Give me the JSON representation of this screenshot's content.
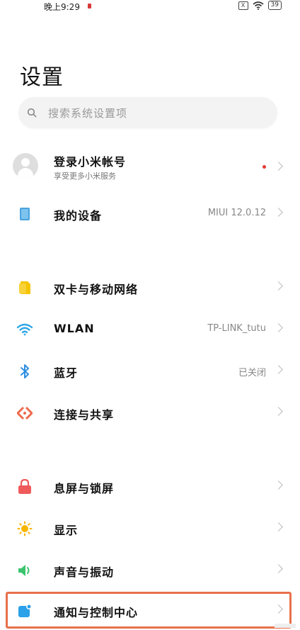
{
  "status_bar": {
    "time": "晚上9:29",
    "sim_badge": "X",
    "battery": "39"
  },
  "page": {
    "title": "设置"
  },
  "search": {
    "placeholder": "搜索系统设置项"
  },
  "account": {
    "title": "登录小米帐号",
    "subtitle": "享受更多小米服务",
    "has_notification": true
  },
  "rows": [
    {
      "label": "我的设备",
      "value": "MIUI 12.0.12",
      "icon": "device-icon"
    },
    {
      "label": "双卡与移动网络",
      "value": "",
      "icon": "sim-card-icon"
    },
    {
      "label": "WLAN",
      "value": "TP-LINK_tutu",
      "icon": "wifi-icon"
    },
    {
      "label": "蓝牙",
      "value": "已关闭",
      "icon": "bluetooth-icon"
    },
    {
      "label": "连接与共享",
      "value": "",
      "icon": "connection-share-icon"
    },
    {
      "label": "息屏与锁屏",
      "value": "",
      "icon": "lock-icon"
    },
    {
      "label": "显示",
      "value": "",
      "icon": "display-brightness-icon"
    },
    {
      "label": "声音与振动",
      "value": "",
      "icon": "speaker-icon"
    },
    {
      "label": "通知与控制中心",
      "value": "",
      "icon": "notification-icon"
    }
  ],
  "colors": {
    "accent_highlight": "#e8704a",
    "device": "#4aa3df",
    "sim": "#f5c400",
    "wifi": "#2ea6e6",
    "bluetooth": "#2f8fe0",
    "share": "#ee6a4b",
    "lock": "#ef5a5a",
    "display": "#f7b500",
    "sound": "#3bc46d",
    "notification": "#2aa1e8"
  }
}
